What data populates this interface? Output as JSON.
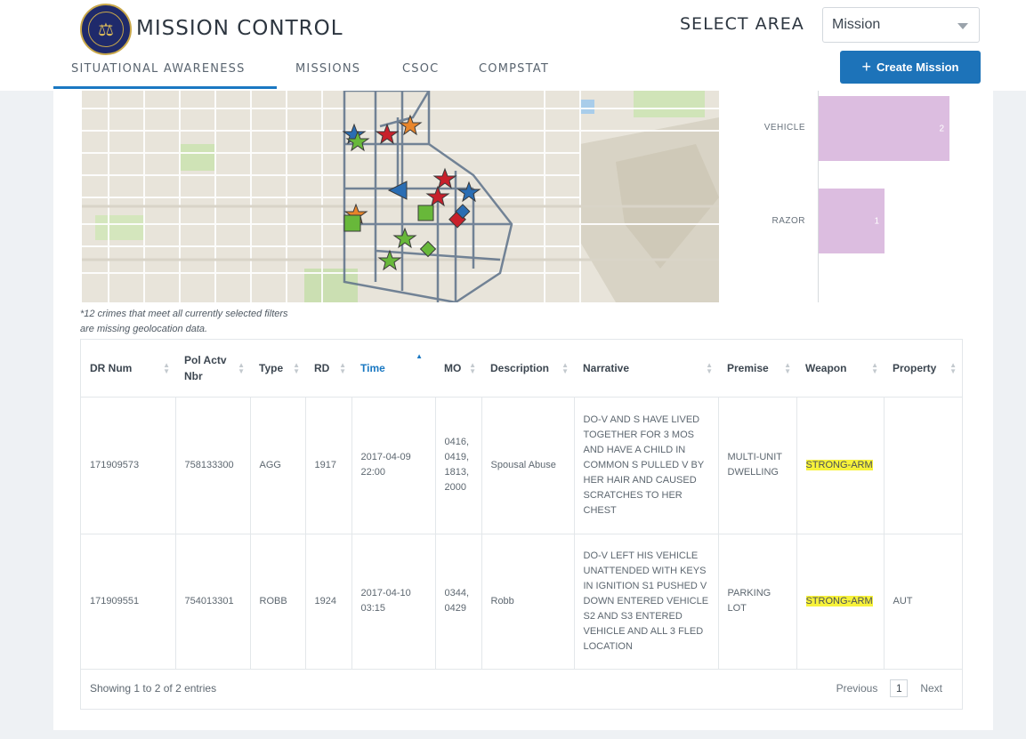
{
  "header": {
    "app_title": "MISSION CONTROL",
    "select_area_label": "SELECT AREA",
    "area_value": "Mission",
    "create_button": "Create Mission",
    "tabs": [
      {
        "label": "SITUATIONAL AWARENESS",
        "active": true
      },
      {
        "label": "MISSIONS",
        "active": false
      },
      {
        "label": "CSOC",
        "active": false
      },
      {
        "label": "COMPSTAT",
        "active": false
      }
    ]
  },
  "weapon_chart": {
    "bars": [
      {
        "label": "VEHICLE",
        "value": 2
      },
      {
        "label": "RAZOR",
        "value": 1
      }
    ],
    "bar_color": "#dcbde0"
  },
  "map_markers": {
    "colors": {
      "red": "#c8202b",
      "blue": "#2a6db3",
      "green": "#68b83a",
      "orange": "#e8852a"
    }
  },
  "footnote": {
    "line1": "*12 crimes that meet all currently selected filters",
    "line2": "are missing geolocation data."
  },
  "table": {
    "columns": [
      "DR Num",
      "Pol Actv Nbr",
      "Type",
      "RD",
      "Time",
      "MO",
      "Description",
      "Narrative",
      "Premise",
      "Weapon",
      "Property"
    ],
    "sorted_column": "Time",
    "rows": [
      {
        "dr_num": "171909573",
        "pol_actv_nbr": "758133300",
        "type": "AGG",
        "rd": "1917",
        "time": "2017-04-09 22:00",
        "mo": "0416, 0419, 1813, 2000",
        "description": "Spousal Abuse",
        "narrative": "DO-V AND S HAVE LIVED TOGETHER FOR 3 MOS AND HAVE A CHILD IN COMMON S PULLED V BY HER HAIR AND CAUSED SCRATCHES TO HER CHEST",
        "premise": "MULTI-UNIT DWELLING",
        "weapon": "STRONG-ARM",
        "property": ""
      },
      {
        "dr_num": "171909551",
        "pol_actv_nbr": "754013301",
        "type": "ROBB",
        "rd": "1924",
        "time": "2017-04-10 03:15",
        "mo": "0344, 0429",
        "description": "Robb",
        "narrative": "DO-V LEFT HIS VEHICLE UNATTENDED WITH KEYS IN IGNITION S1 PUSHED V DOWN ENTERED VEHICLE S2 AND S3 ENTERED VEHICLE AND ALL 3 FLED LOCATION",
        "premise": "PARKING LOT",
        "weapon": "STRONG-ARM",
        "property": "AUT"
      }
    ],
    "showing_text": "Showing 1 to 2 of 2 entries",
    "pagination": {
      "previous": "Previous",
      "current_page": "1",
      "next": "Next"
    }
  }
}
